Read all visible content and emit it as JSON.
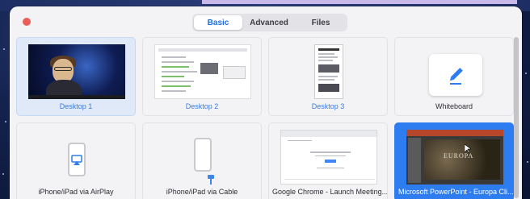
{
  "tabs": [
    {
      "label": "Basic",
      "active": true
    },
    {
      "label": "Advanced",
      "active": false
    },
    {
      "label": "Files",
      "active": false
    }
  ],
  "share_items": [
    {
      "label": "Desktop 1",
      "kind": "screen",
      "state": "highlighted"
    },
    {
      "label": "Desktop 2",
      "kind": "screen",
      "state": "normal"
    },
    {
      "label": "Desktop 3",
      "kind": "screen",
      "state": "normal"
    },
    {
      "label": "Whiteboard",
      "kind": "whiteboard",
      "icon": "pencil-icon",
      "state": "normal"
    },
    {
      "label": "iPhone/iPad via AirPlay",
      "kind": "device",
      "icon": "airplay-icon",
      "state": "normal"
    },
    {
      "label": "iPhone/iPad via Cable",
      "kind": "device",
      "icon": "cable-icon",
      "state": "normal"
    },
    {
      "label": "Google Chrome - Launch Meeting...",
      "kind": "window",
      "state": "normal"
    },
    {
      "label": "Microsoft PowerPoint - Europa Cli...",
      "kind": "window",
      "state": "selected"
    }
  ],
  "thumbnails": {
    "powerpoint_slide_title": "EUROPA"
  },
  "colors": {
    "accent": "#2d7cf0",
    "close_dot": "#ec5d57",
    "panel_bg": "#f3f3f5"
  }
}
